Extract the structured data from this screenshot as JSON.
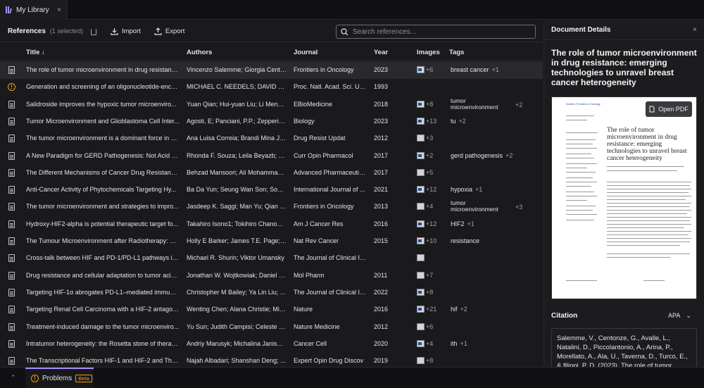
{
  "tab": {
    "title": "My Library",
    "close": "×"
  },
  "toolbar": {
    "references": "References",
    "selected": "(1 selected)",
    "import": "Import",
    "export": "Export",
    "search_placeholder": "Search references..."
  },
  "columns": {
    "title": "Title",
    "authors": "Authors",
    "journal": "Journal",
    "year": "Year",
    "images": "Images",
    "tags": "Tags"
  },
  "rows": [
    {
      "status": "doc",
      "title": "The role of tumor microenvironment in drug resistance...",
      "authors": "Vincenzo Salemme; Giorgia Cento...",
      "journal": "Frontiers in Oncology",
      "year": "2023",
      "img_count": "+6",
      "tag": "breast cancer",
      "tag_more": "+1"
    },
    {
      "status": "warn",
      "title": "Generation and screening of an oligonucleotide-enco...",
      "authors": "MICHAEL C. NEEDELS; DAVID G. J...",
      "journal": "Proc. Natl. Acad. Sci. USA",
      "year": "1993",
      "img_count": "",
      "tag": "",
      "tag_more": ""
    },
    {
      "status": "doc",
      "title": "Salidroside improves the hypoxic tumor microenviro...",
      "authors": "Yuan Qian; Hui-yuan Liu; Li Meng;...",
      "journal": "EBioMedicine",
      "year": "2018",
      "img_count": "+8",
      "tag": "tumor microenvironment",
      "tag_more": "+2"
    },
    {
      "status": "doc",
      "title": "Tumor Microenvironment and Glioblastoma Cell Inter...",
      "authors": "Agosti, E; Panciani, P.P.; Zepperi, ...",
      "journal": "Biology",
      "year": "2023",
      "img_count": "+13",
      "tag": "tu",
      "tag_more": "+2"
    },
    {
      "status": "doc",
      "title": "The tumor microenvironment is a dominant force in m...",
      "authors": "Ana Luisa Correia; Brandi Mina J. ...",
      "journal": "Drug Resist Updat",
      "year": "2012",
      "img_count": "+3",
      "tag": "",
      "tag_more": ""
    },
    {
      "status": "doc",
      "title": "A New Paradigm for GERD Pathogenesis: Not Acid Inj...",
      "authors": "Rhonda F. Souza; Leila Beyazb; St...",
      "journal": "Curr Opin Pharmacol",
      "year": "2017",
      "img_count": "+2",
      "tag": "gerd pathogenesis",
      "tag_more": "+2"
    },
    {
      "status": "doc",
      "title": "The Different Mechanisms of Cancer Drug Resistance...",
      "authors": "Behzad Mansoori; Ali Mohammad;...",
      "journal": "Advanced Pharmaceutic...",
      "year": "2017",
      "img_count": "+5",
      "tag": "",
      "tag_more": ""
    },
    {
      "status": "doc",
      "title": "Anti-Cancer Activity of Phytochemicals Targeting Hy...",
      "authors": "Ba Da Yun; Seung Wan Son; Soo Y...",
      "journal": "International Journal of ...",
      "year": "2021",
      "img_count": "+12",
      "tag": "hypoxia",
      "tag_more": "+1"
    },
    {
      "status": "doc",
      "title": "The tumor microenvironment and strategies to impro...",
      "authors": "Jasdeep K. Saggi; Man Yu; Qian T...",
      "journal": "Frontiers in Oncology",
      "year": "2013",
      "img_count": "+4",
      "tag": "tumor microenvironment",
      "tag_more": "+3"
    },
    {
      "status": "doc",
      "title": "Hydroxy-HIF2-alpha is potential therapeutic target fo...",
      "authors": "Takahiro Isono1; Tokihiro Chano2; ...",
      "journal": "Am J Cancer Res",
      "year": "2016",
      "img_count": "+12",
      "tag": "HIF2",
      "tag_more": "+1"
    },
    {
      "status": "doc",
      "title": "The Tumour Microenvironment after Radiotherapy: M...",
      "authors": "Holly E Barker; James T.E. Page; A...",
      "journal": "Nat Rev Cancer",
      "year": "2015",
      "img_count": "+10",
      "tag": "resistance",
      "tag_more": ""
    },
    {
      "status": "doc",
      "title": "Cross-talk between HIF and PD-1/PD-L1 pathways in ...",
      "authors": "Michael R. Shurin; Viktor Umansky",
      "journal": "The Journal of Clinical In...",
      "year": "",
      "img_count": "",
      "tag": "",
      "tag_more": ""
    },
    {
      "status": "doc",
      "title": "Drug resistance and cellular adaptation to tumor acidi...",
      "authors": "Jonathan W. Wojtkowiak; Daniel V...",
      "journal": "Mol Pharm",
      "year": "2011",
      "img_count": "+7",
      "tag": "",
      "tag_more": ""
    },
    {
      "status": "doc",
      "title": "Targeting HIF-1α abrogates PD-L1–mediated immune ...",
      "authors": "Christopher M Bailey; Ya Lin Liu; ...",
      "journal": "The Journal of Clinical In...",
      "year": "2022",
      "img_count": "+8",
      "tag": "",
      "tag_more": ""
    },
    {
      "status": "doc",
      "title": "Targeting Renal Cell Carcinoma with a HIF-2 antagonist",
      "authors": "Wenting Chen; Alana Christie; Min...",
      "journal": "Nature",
      "year": "2016",
      "img_count": "+21",
      "tag": "hif",
      "tag_more": "+2"
    },
    {
      "status": "doc",
      "title": "Treatment-induced damage to the tumor microenviro...",
      "authors": "Yu Sun; Judith Campisi; Celeste H...",
      "journal": "Nature Medicine",
      "year": "2012",
      "img_count": "+6",
      "tag": "",
      "tag_more": ""
    },
    {
      "status": "doc",
      "title": "Intratumor heterogeneity: the Rosetta stone of therap...",
      "authors": "Andriy Marusyk; Michalina Janisze...",
      "journal": "Cancer Cell",
      "year": "2020",
      "img_count": "+4",
      "tag": "ith",
      "tag_more": "+1"
    },
    {
      "status": "doc",
      "title": "The Transcriptional Factors HIF-1 and HIF-2 and Thei...",
      "authors": "Najah Albadari; Shanshan Deng; ...",
      "journal": "Expert Opin Drug Discov",
      "year": "2019",
      "img_count": "+8",
      "tag": "",
      "tag_more": ""
    }
  ],
  "details": {
    "header": "Document Details",
    "close": "×",
    "title": "The role of tumor microenvironment in drug resistance: emerging technologies to unravel breast cancer heterogeneity",
    "open_pdf": "Open PDF",
    "pdf_journal": "frontiers | Frontiers in Oncology",
    "pdf_title": "The role of tumor microenvironment in drug resistance: emerging technologies to unravel breast cancer heterogeneity",
    "citation_label": "Citation",
    "citation_style": "APA",
    "citation_text": "Salemme, V., Centonze, G., Avalle, L., Natalini, D., Piccolantonio, A., Arina, P., Morellato, A., Ala, U., Taverna, D., Turco, E., & filippi, P. D. (2023). The role of tumor"
  },
  "bottom": {
    "problems": "Problems",
    "beta": "Beta"
  }
}
